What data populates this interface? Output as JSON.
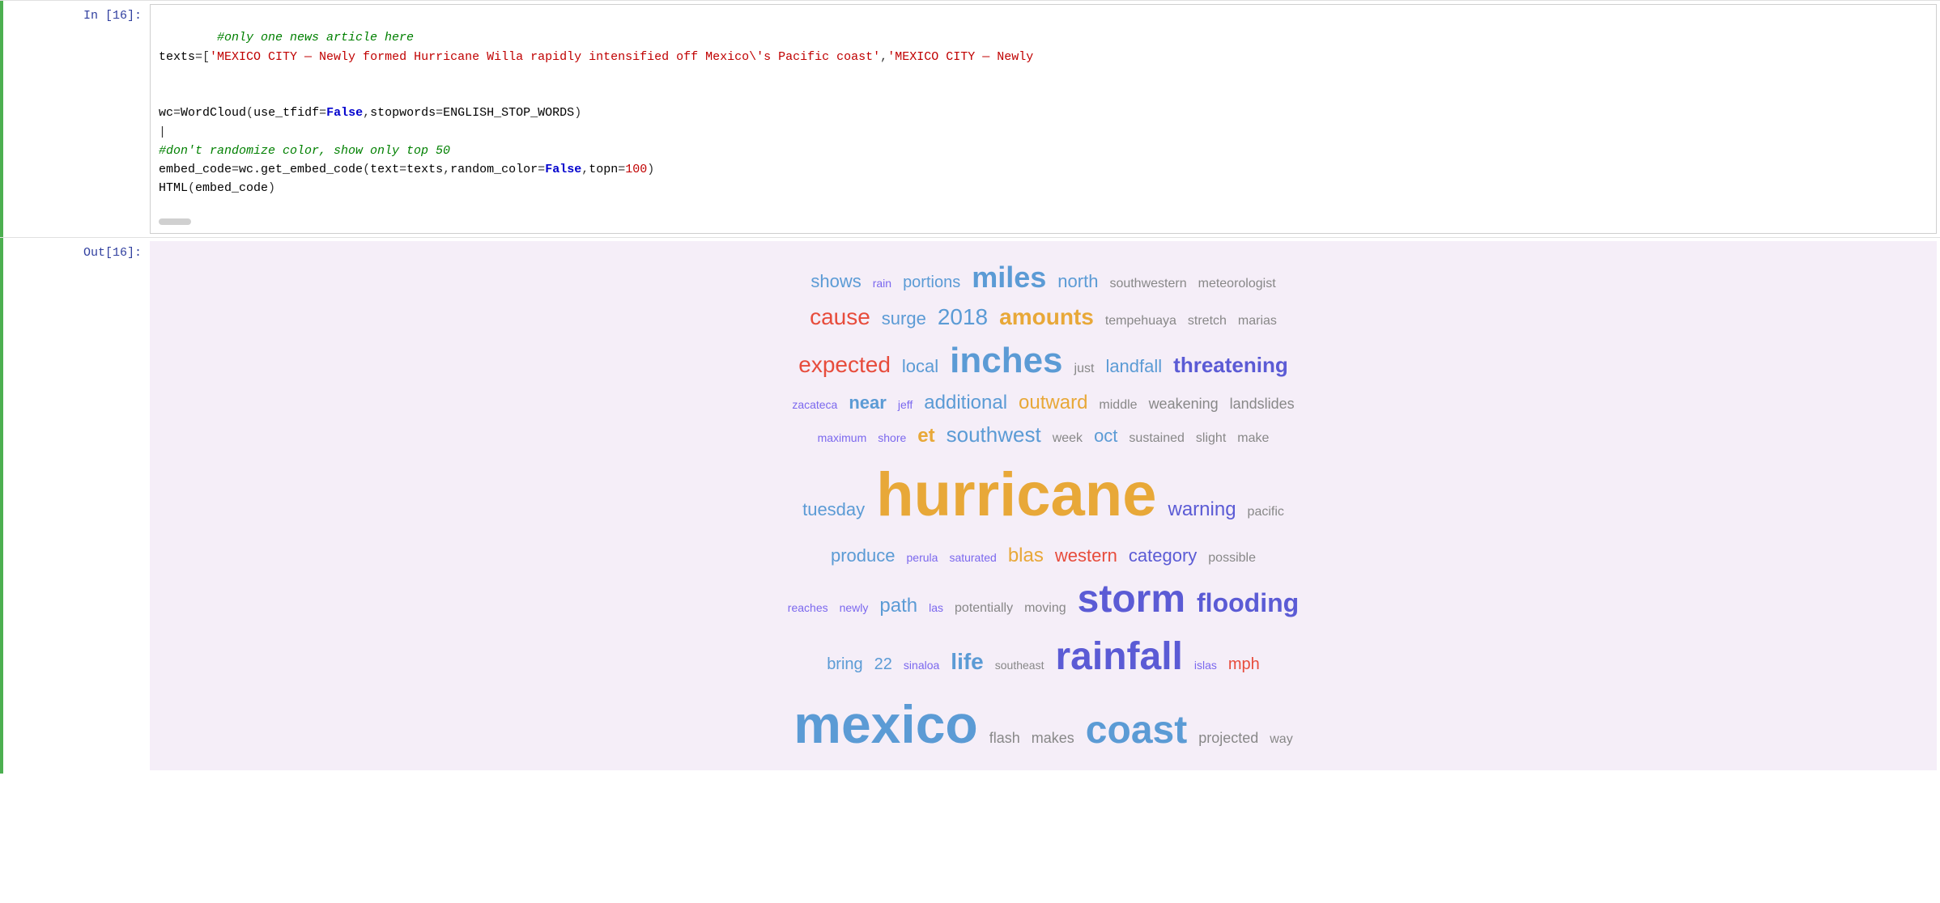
{
  "cells": [
    {
      "id": "in16",
      "label": "In [16]:",
      "type": "input",
      "code_lines": [
        {
          "type": "comment",
          "text": "#only one news article here"
        },
        {
          "type": "code",
          "html": "<span class='c-var'>texts</span><span>=[</span><span class='c-string'>'MEXICO CITY — Newly formed Hurricane Willa rapidly intensified off Mexico\\'s Pacific coast'</span><span>,</span><span class='c-string'>'MEXICO CITY — Newly</span>"
        },
        {
          "type": "blank"
        },
        {
          "type": "blank"
        },
        {
          "type": "code",
          "html": "<span class='c-var'>wc</span><span>=</span><span class='c-func'>WordCloud</span><span>(</span><span class='c-param'>use_tfidf</span><span>=</span><span class='c-keyword'>False</span><span>,</span><span class='c-param'>stopwords</span><span>=</span><span class='c-var'>ENGLISH_STOP_WORDS</span><span>)</span>"
        },
        {
          "type": "cursor"
        },
        {
          "type": "comment",
          "text": "#don't randomize color, show only top 50"
        },
        {
          "type": "code",
          "html": "<span class='c-var'>embed_code</span><span>=</span><span class='c-func'>wc.get_embed_code</span><span>(</span><span class='c-param'>text</span><span>=</span><span class='c-var'>texts</span><span>,</span><span class='c-param'>random_color</span><span>=</span><span class='c-keyword'>False</span><span>,</span><span class='c-param'>topn</span><span>=</span><span class='c-val'>100</span><span>)</span>"
        },
        {
          "type": "code",
          "html": "<span class='c-func'>HTML</span><span>(</span><span class='c-var'>embed_code</span><span>)</span>"
        }
      ]
    }
  ],
  "output": {
    "label": "Out[16]:",
    "wordcloud": {
      "rows": [
        [
          {
            "word": "shows",
            "size": 22,
            "color": "#5b9bd5",
            "weight": "normal"
          },
          {
            "word": "rain",
            "size": 14,
            "color": "#7b68ee",
            "weight": "normal"
          },
          {
            "word": "portions",
            "size": 20,
            "color": "#5b9bd5",
            "weight": "normal"
          },
          {
            "word": "miles",
            "size": 36,
            "color": "#5b9bd5",
            "weight": "bold"
          },
          {
            "word": "north",
            "size": 22,
            "color": "#5b9bd5",
            "weight": "normal"
          },
          {
            "word": "southwestern",
            "size": 16,
            "color": "#888",
            "weight": "normal"
          },
          {
            "word": "meteorologist",
            "size": 16,
            "color": "#888",
            "weight": "normal"
          }
        ],
        [
          {
            "word": "cause",
            "size": 28,
            "color": "#e74c3c",
            "weight": "normal"
          },
          {
            "word": "surge",
            "size": 22,
            "color": "#5b9bd5",
            "weight": "normal"
          },
          {
            "word": "2018",
            "size": 28,
            "color": "#5b9bd5",
            "weight": "normal"
          },
          {
            "word": "amounts",
            "size": 28,
            "color": "#e8a838",
            "weight": "bold"
          },
          {
            "word": "tempehuaya",
            "size": 16,
            "color": "#888",
            "weight": "normal"
          },
          {
            "word": "stretch",
            "size": 16,
            "color": "#888",
            "weight": "normal"
          },
          {
            "word": "marias",
            "size": 16,
            "color": "#888",
            "weight": "normal"
          }
        ],
        [
          {
            "word": "expected",
            "size": 28,
            "color": "#e74c3c",
            "weight": "normal"
          },
          {
            "word": "local",
            "size": 22,
            "color": "#5b9bd5",
            "weight": "normal"
          },
          {
            "word": "inches",
            "size": 42,
            "color": "#5b9bd5",
            "weight": "bold"
          },
          {
            "word": "just",
            "size": 16,
            "color": "#888",
            "weight": "normal"
          },
          {
            "word": "landfall",
            "size": 22,
            "color": "#5b9bd5",
            "weight": "normal"
          },
          {
            "word": "threatening",
            "size": 26,
            "color": "#5b5bd5",
            "weight": "bold"
          }
        ],
        [
          {
            "word": "zacateca",
            "size": 14,
            "color": "#7b68ee",
            "weight": "normal"
          },
          {
            "word": "near",
            "size": 22,
            "color": "#5b9bd5",
            "weight": "bold"
          },
          {
            "word": "jeff",
            "size": 14,
            "color": "#7b68ee",
            "weight": "normal"
          },
          {
            "word": "additional",
            "size": 24,
            "color": "#5b9bd5",
            "weight": "normal"
          },
          {
            "word": "outward",
            "size": 24,
            "color": "#e8a838",
            "weight": "normal"
          },
          {
            "word": "middle",
            "size": 16,
            "color": "#888",
            "weight": "normal"
          },
          {
            "word": "weakening",
            "size": 18,
            "color": "#888",
            "weight": "normal"
          },
          {
            "word": "landslides",
            "size": 18,
            "color": "#888",
            "weight": "normal"
          }
        ],
        [
          {
            "word": "maximum",
            "size": 14,
            "color": "#7b68ee",
            "weight": "normal"
          },
          {
            "word": "shore",
            "size": 14,
            "color": "#7b68ee",
            "weight": "normal"
          },
          {
            "word": "et",
            "size": 24,
            "color": "#e8a838",
            "weight": "bold"
          },
          {
            "word": "southwest",
            "size": 26,
            "color": "#5b9bd5",
            "weight": "normal"
          },
          {
            "word": "week",
            "size": 16,
            "color": "#888",
            "weight": "normal"
          },
          {
            "word": "oct",
            "size": 22,
            "color": "#5b9bd5",
            "weight": "normal"
          },
          {
            "word": "sustained",
            "size": 16,
            "color": "#888",
            "weight": "normal"
          },
          {
            "word": "slight",
            "size": 16,
            "color": "#888",
            "weight": "normal"
          },
          {
            "word": "make",
            "size": 16,
            "color": "#888",
            "weight": "normal"
          }
        ],
        [
          {
            "word": "tuesday",
            "size": 22,
            "color": "#5b9bd5",
            "weight": "normal"
          },
          {
            "word": "hurricane",
            "size": 72,
            "color": "#e8a838",
            "weight": "bold"
          },
          {
            "word": "warning",
            "size": 24,
            "color": "#5b5bd5",
            "weight": "normal"
          },
          {
            "word": "pacific",
            "size": 16,
            "color": "#888",
            "weight": "normal"
          }
        ],
        [
          {
            "word": "produce",
            "size": 22,
            "color": "#5b9bd5",
            "weight": "normal"
          },
          {
            "word": "perula",
            "size": 14,
            "color": "#7b68ee",
            "weight": "normal"
          },
          {
            "word": "saturated",
            "size": 14,
            "color": "#7b68ee",
            "weight": "normal"
          },
          {
            "word": "blas",
            "size": 24,
            "color": "#e8a838",
            "weight": "normal"
          },
          {
            "word": "western",
            "size": 22,
            "color": "#e74c3c",
            "weight": "normal"
          },
          {
            "word": "category",
            "size": 22,
            "color": "#5b5bd5",
            "weight": "normal"
          },
          {
            "word": "possible",
            "size": 16,
            "color": "#888",
            "weight": "normal"
          }
        ],
        [
          {
            "word": "reaches",
            "size": 14,
            "color": "#7b68ee",
            "weight": "normal"
          },
          {
            "word": "newly",
            "size": 14,
            "color": "#7b68ee",
            "weight": "normal"
          },
          {
            "word": "path",
            "size": 24,
            "color": "#5b9bd5",
            "weight": "normal"
          },
          {
            "word": "las",
            "size": 14,
            "color": "#7b68ee",
            "weight": "normal"
          },
          {
            "word": "potentially",
            "size": 16,
            "color": "#888",
            "weight": "normal"
          },
          {
            "word": "moving",
            "size": 16,
            "color": "#888",
            "weight": "normal"
          },
          {
            "word": "storm",
            "size": 46,
            "color": "#5b5bd5",
            "weight": "bold"
          },
          {
            "word": "flooding",
            "size": 32,
            "color": "#5b5bd5",
            "weight": "bold"
          }
        ],
        [
          {
            "word": "bring",
            "size": 20,
            "color": "#5b9bd5",
            "weight": "normal"
          },
          {
            "word": "22",
            "size": 20,
            "color": "#5b9bd5",
            "weight": "normal"
          },
          {
            "word": "sinaloa",
            "size": 14,
            "color": "#7b68ee",
            "weight": "normal"
          },
          {
            "word": "life",
            "size": 28,
            "color": "#5b9bd5",
            "weight": "bold"
          },
          {
            "word": "southeast",
            "size": 14,
            "color": "#888",
            "weight": "normal"
          },
          {
            "word": "rainfall",
            "size": 46,
            "color": "#5b5bd5",
            "weight": "bold"
          },
          {
            "word": "islas",
            "size": 14,
            "color": "#7b68ee",
            "weight": "normal"
          },
          {
            "word": "mph",
            "size": 20,
            "color": "#e74c3c",
            "weight": "normal"
          }
        ],
        [
          {
            "word": "mexico",
            "size": 64,
            "color": "#5b9bd5",
            "weight": "bold"
          },
          {
            "word": "flash",
            "size": 18,
            "color": "#888",
            "weight": "normal"
          },
          {
            "word": "makes",
            "size": 18,
            "color": "#888",
            "weight": "normal"
          },
          {
            "word": "coast",
            "size": 46,
            "color": "#5b9bd5",
            "weight": "bold"
          },
          {
            "word": "projected",
            "size": 18,
            "color": "#888",
            "weight": "normal"
          },
          {
            "word": "way",
            "size": 16,
            "color": "#888",
            "weight": "normal"
          }
        ]
      ]
    }
  }
}
